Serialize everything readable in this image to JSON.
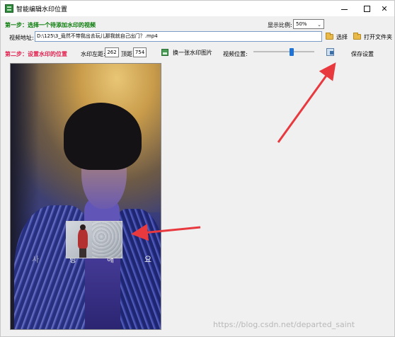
{
  "window": {
    "title": "智能编辑水印位置",
    "controls": {
      "minimize": "—",
      "maximize": "□",
      "close": "✕"
    }
  },
  "step1": {
    "label": "第一步：选择一个待添加水印的视频",
    "ratio_label": "显示比例:",
    "ratio_value": "50%",
    "path_label": "视频地址:",
    "path_value": "D:\\125\\3_竟然不带我出去玩儿那我就自己出门？.mp4",
    "select_button": "选择",
    "open_folder_button": "打开文件夹"
  },
  "step2": {
    "label": "第二步：设置水印的位置",
    "left_label": "水印左距:",
    "left_value": "262",
    "top_label": "顶距:",
    "top_value": "754",
    "change_button": "换一张水印图片",
    "video_pos_label": "视频位置:",
    "video_position": 0.63,
    "save_button": "保存设置"
  },
  "preview": {
    "subtitle_chars": [
      "사",
      "랑",
      "해",
      "요"
    ]
  },
  "watermark_url": "https://blog.csdn.net/departed_saint",
  "colors": {
    "step1": "#0a7c0a",
    "step2": "#e0204e",
    "arrow": "#e8393f",
    "slider": "#1e73d8"
  },
  "icons": [
    "app-icon",
    "minimize-icon",
    "maximize-icon",
    "close-icon",
    "folder-icon",
    "image-icon",
    "save-icon",
    "dropdown-caret-icon"
  ]
}
